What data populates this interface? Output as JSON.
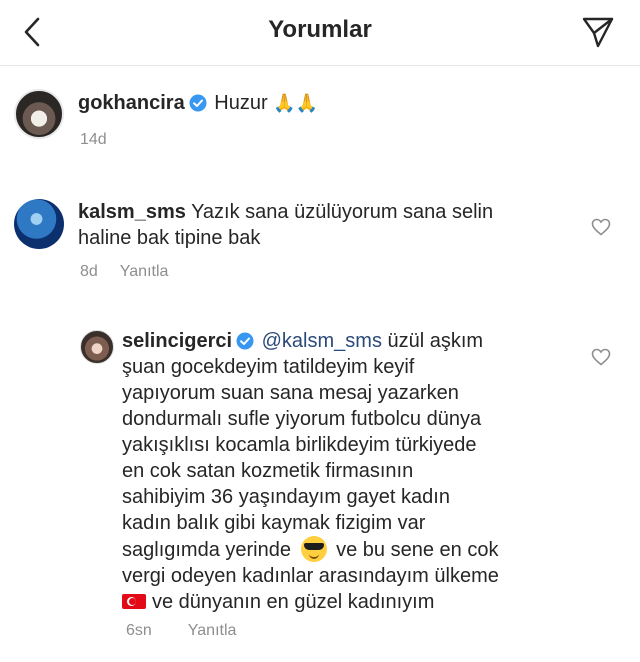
{
  "header": {
    "title": "Yorumlar",
    "back_icon": "chevron-left-icon",
    "send_icon": "paper-plane-icon"
  },
  "caption": {
    "username": "gokhancira",
    "verified": true,
    "text": "Huzur",
    "emoji": "🙏🙏",
    "time": "14d"
  },
  "comments": [
    {
      "username": "kalsm_sms",
      "line1": "Yazık sana üzülüyorum sana selin",
      "line2": "haline bak tipine bak",
      "time": "8d",
      "reply_label": "Yanıtla"
    },
    {
      "username": "selincigerci",
      "verified": true,
      "mention": "@kalsm_sms",
      "lines": [
        "üzül aşkım",
        "şuan gocekdeyim tatildeyim keyif",
        "yapıyorum suan sana mesaj yazarken",
        "dondurmalı sufle  yiyorum  futbolcu dünya",
        "yakışıklısı kocamla birlikdeyim türkiyede",
        "en cok satan kozmetik firmasının",
        "sahibiyim 36 yaşındayım gayet kadın",
        "kadın balık gibi kaymak fizigim var",
        "saglıgımda yerinde",
        "ve bu sene en cok",
        "vergi odeyen kadınlar arasındayım ülkeme",
        "ve dünyanın en güzel kadınıyım"
      ],
      "time": "6sn",
      "reply_label": "Yanıtla"
    }
  ],
  "colors": {
    "text": "#262626",
    "meta": "#8e8e8e",
    "verified": "#3897f0",
    "mention": "#2b4a78"
  }
}
